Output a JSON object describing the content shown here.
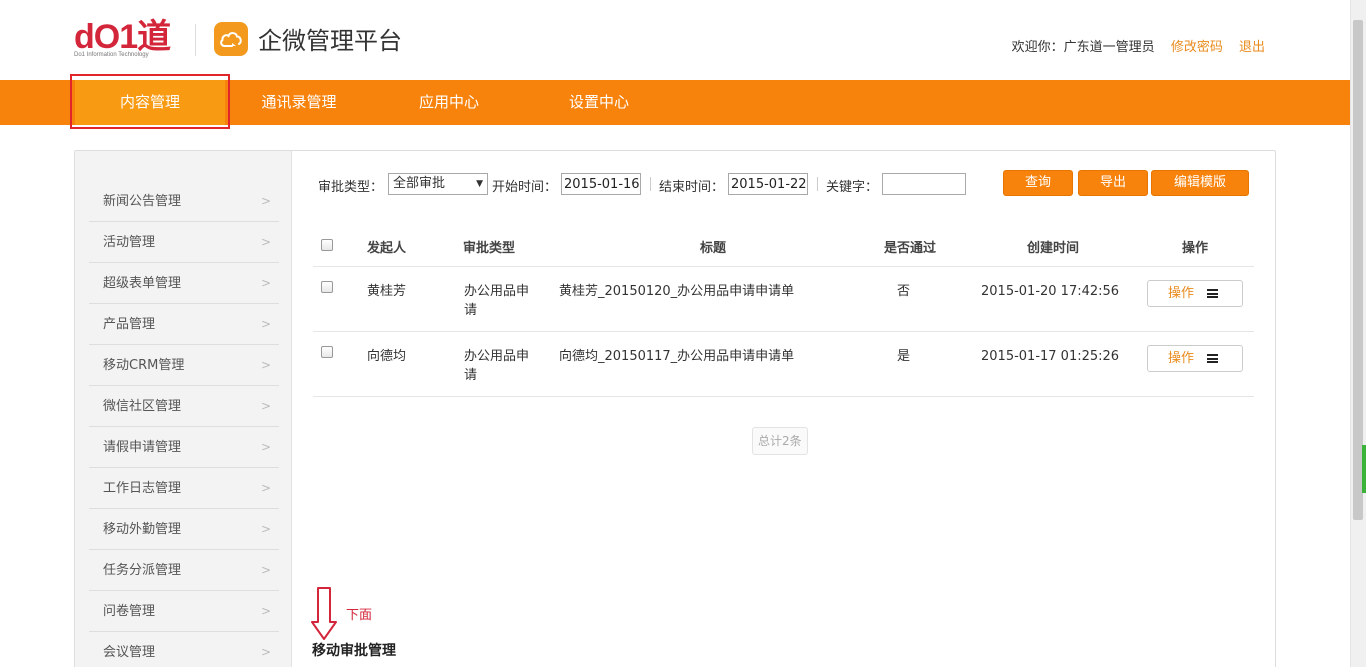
{
  "header": {
    "logo_text": "dO1道",
    "logo_sub": "Do1 Information Technology",
    "app_title": "企微管理平台",
    "welcome": "欢迎你：广东道一管理员",
    "change_password": "修改密码",
    "logout": "退出"
  },
  "nav": {
    "items": [
      {
        "label": "内容管理"
      },
      {
        "label": "通讯录管理"
      },
      {
        "label": "应用中心"
      },
      {
        "label": "设置中心"
      }
    ]
  },
  "sidebar": {
    "items": [
      {
        "label": "新闻公告管理"
      },
      {
        "label": "活动管理"
      },
      {
        "label": "超级表单管理"
      },
      {
        "label": "产品管理"
      },
      {
        "label": "移动CRM管理"
      },
      {
        "label": "微信社区管理"
      },
      {
        "label": "请假申请管理"
      },
      {
        "label": "工作日志管理"
      },
      {
        "label": "移动外勤管理"
      },
      {
        "label": "任务分派管理"
      },
      {
        "label": "问卷管理"
      },
      {
        "label": "会议管理"
      }
    ]
  },
  "filters": {
    "type_label": "审批类型：",
    "type_value": "全部审批",
    "start_label": "开始时间：",
    "start_value": "2015-01-16",
    "end_label": "结束时间：",
    "end_value": "2015-01-22",
    "keyword_label": "关键字：",
    "keyword_value": "",
    "query_btn": "查询",
    "export_btn": "导出",
    "edit_template_btn": "编辑模版"
  },
  "table": {
    "headers": {
      "initiator": "发起人",
      "type": "审批类型",
      "title": "标题",
      "passed": "是否通过",
      "created": "创建时间",
      "action": "操作"
    },
    "rows": [
      {
        "initiator": "黄桂芳",
        "type_line1": "办公用品申",
        "type_line2": "请",
        "title": "黄桂芳_20150120_办公用品申请申请单",
        "passed": "否",
        "created": "2015-01-20 17:42:56",
        "action": "操作"
      },
      {
        "initiator": "向德均",
        "type_line1": "办公用品申",
        "type_line2": "请",
        "title": "向德均_20150117_办公用品申请申请单",
        "passed": "是",
        "created": "2015-01-17 01:25:26",
        "action": "操作"
      }
    ],
    "total": "总计2条"
  },
  "annotation": {
    "arrow_text": "下面",
    "bottom_title": "移动审批管理"
  },
  "colors": {
    "nav_bg": "#f7830d",
    "nav_active": "#f89a12",
    "brand_red": "#d4263a",
    "link_orange": "#e98b1d"
  }
}
